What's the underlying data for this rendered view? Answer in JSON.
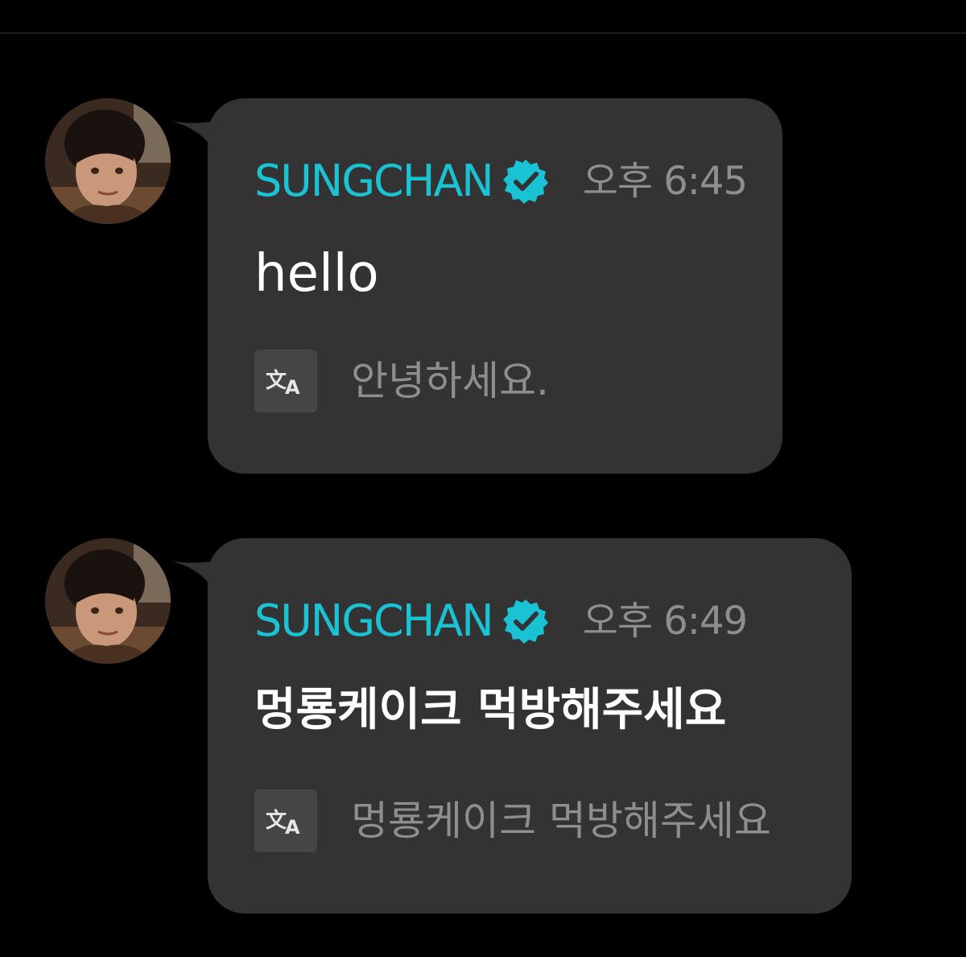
{
  "theme": {
    "background": "#000000",
    "bubble": "#333333",
    "author_color": "#19c3d4",
    "verified_color": "#19c3d4",
    "meta_color": "#8e8e8e",
    "text_color": "#ffffff",
    "translate_icon_bg": "#454545"
  },
  "messages": [
    {
      "author": "SUNGCHAN",
      "verified_icon": "verified-badge-icon",
      "time": "오후 6:45",
      "text": "hello",
      "translate_icon": "translate-icon",
      "translation": "안녕하세요."
    },
    {
      "author": "SUNGCHAN",
      "verified_icon": "verified-badge-icon",
      "time": "오후 6:49",
      "text": "멍룡케이크 먹방해주세요",
      "translate_icon": "translate-icon",
      "translation": "멍룡케이크 먹방해주세요"
    }
  ]
}
